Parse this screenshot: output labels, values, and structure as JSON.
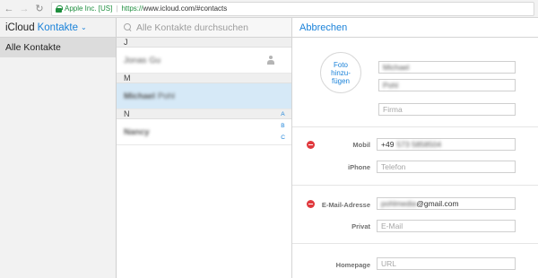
{
  "browser": {
    "back_icon": "back-arrow-icon",
    "forward_icon": "forward-arrow-icon",
    "reload_icon": "reload-icon",
    "cert_owner": "Apple Inc. [US]",
    "url_scheme": "https://",
    "url_rest": "www.icloud.com/#contacts"
  },
  "header": {
    "brand": "iCloud",
    "app_name": "Kontakte",
    "search_placeholder": "Alle Kontakte durchsuchen",
    "cancel_label": "Abbrechen"
  },
  "groups": {
    "items": [
      {
        "label": "Alle Kontakte"
      }
    ]
  },
  "contacts": {
    "sections": [
      {
        "letter": "J",
        "rows": [
          {
            "first": "Jonas",
            "last": "Gu"
          }
        ]
      },
      {
        "letter": "M",
        "rows": [
          {
            "first": "Michael",
            "last": "Pohl"
          }
        ]
      },
      {
        "letter": "N",
        "rows": [
          {
            "first": "Nancy",
            "last": ""
          }
        ]
      }
    ],
    "index": [
      "A",
      "B",
      "C"
    ]
  },
  "detail": {
    "photo_label_1": "Foto",
    "photo_label_2": "hinzu-",
    "photo_label_3": "fügen",
    "first_name": "Michael",
    "last_name": "Pohl",
    "company_placeholder": "Firma",
    "mobile_label": "Mobil",
    "mobile_prefix": "+49",
    "mobile_value": "573 5858504",
    "iphone_label": "iPhone",
    "phone_placeholder": "Telefon",
    "email_label": "E-Mail-Adresse",
    "email_local": "pohlmedia",
    "email_domain": "@gmail.com",
    "private_label": "Privat",
    "email_placeholder": "E-Mail",
    "homepage_label": "Homepage",
    "url_placeholder": "URL"
  }
}
